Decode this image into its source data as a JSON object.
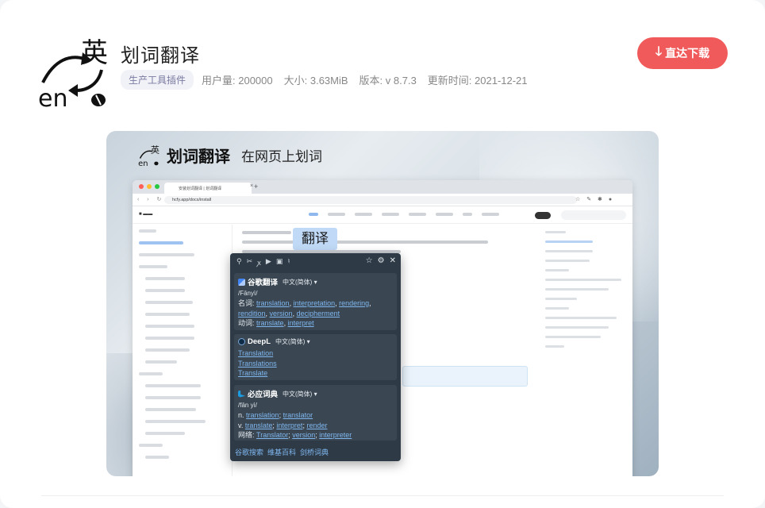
{
  "app": {
    "title": "划词翻译",
    "category": "生产工具插件",
    "users": "用户量: 200000",
    "size": "大小: 3.63MiB",
    "version": "版本: v 8.7.3",
    "updated": "更新时间: 2021-12-21",
    "download_label": "直达下载",
    "logo_text_top": "英",
    "logo_text_bottom": "en"
  },
  "screenshot": {
    "name": "划词翻译",
    "tagline": "在网页上划词",
    "tab_title": "安装划词翻译 | 划词翻译",
    "url": "hcfy.app/docs/install",
    "selected_word": "翻译",
    "google": {
      "name": "谷歌翻译",
      "lang": "中文(简体) ▾",
      "phonetic": "/Fānyì/",
      "noun_prefix": "名词:",
      "noun_links": [
        "translation",
        "interpretation",
        "rendering",
        "rendition",
        "version",
        "decipherment"
      ],
      "verb_prefix": "动词:",
      "verb_links": [
        "translate",
        "interpret"
      ]
    },
    "deepl": {
      "name": "DeepL",
      "lang": "中文(简体) ▾",
      "results": [
        "Translation",
        "Translations",
        "Translate"
      ]
    },
    "bing": {
      "name": "必应词典",
      "lang": "中文(简体) ▾",
      "phonetic": "/fān yì/",
      "n_prefix": "n.",
      "n_links": [
        "translation",
        "translator"
      ],
      "v_prefix": "v.",
      "v_links": [
        "translate",
        "interpret",
        "render"
      ],
      "web_prefix": "网络:",
      "web_links": [
        "Translator",
        "version",
        "interpreter"
      ]
    },
    "footer_links": [
      "谷歌搜索",
      "维基百科",
      "剑桥词典"
    ]
  },
  "colors": {
    "accent": "#f05a5a",
    "popup_bg": "#2e3b47",
    "link": "#7fb6ee"
  }
}
